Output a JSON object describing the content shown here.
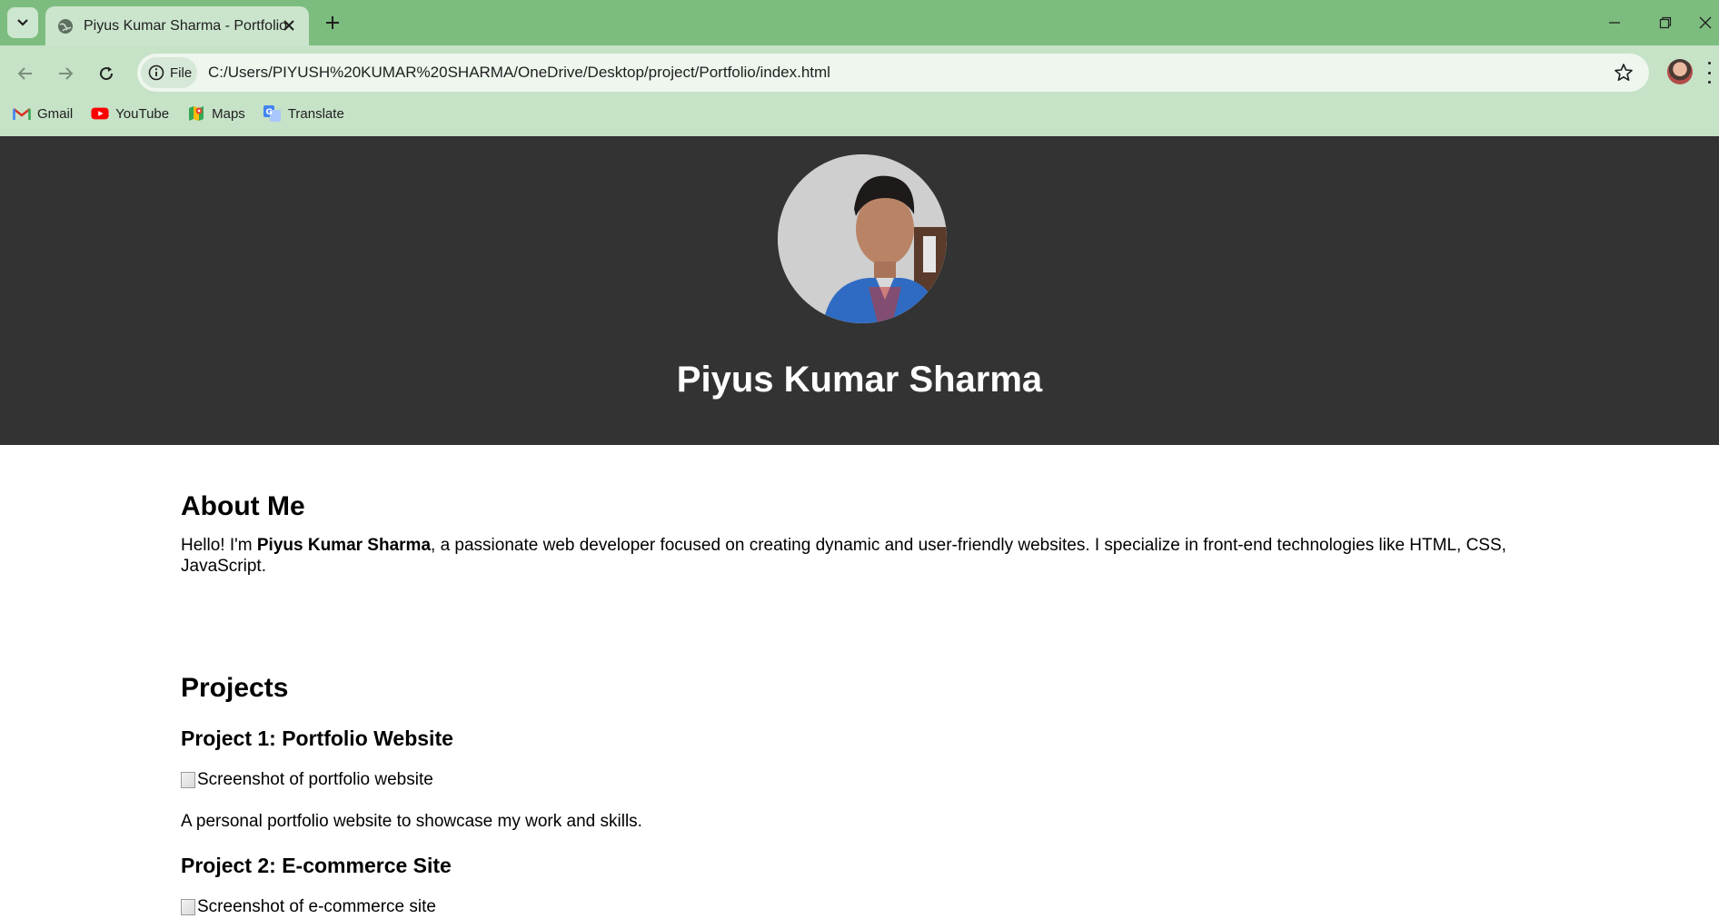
{
  "browser": {
    "tab": {
      "title": "Piyus Kumar Sharma - Portfolio"
    },
    "omnibox": {
      "chip_label": "File",
      "url": "C:/Users/PIYUSH%20KUMAR%20SHARMA/OneDrive/Desktop/project/Portfolio/index.html"
    },
    "bookmarks": [
      {
        "label": "Gmail",
        "icon": "gmail-icon"
      },
      {
        "label": "YouTube",
        "icon": "youtube-icon"
      },
      {
        "label": "Maps",
        "icon": "maps-icon"
      },
      {
        "label": "Translate",
        "icon": "translate-icon"
      }
    ],
    "colors": {
      "tabbar": "#7cbd7f",
      "toolbar": "#c6e2c7",
      "active_tab": "#cbe5cd"
    }
  },
  "page": {
    "header": {
      "name": "Piyus Kumar Sharma",
      "background": "#333333"
    },
    "about": {
      "heading": "About Me",
      "text_before": "Hello! I'm ",
      "text_bold": "Piyus Kumar Sharma",
      "text_after": ", a passionate web developer focused on creating dynamic and user-friendly websites. I specialize in front-end technologies like HTML, CSS, JavaScript."
    },
    "projects": {
      "heading": "Projects",
      "items": [
        {
          "title": "Project 1: Portfolio Website",
          "image_alt": "Screenshot of portfolio website",
          "description": "A personal portfolio website to showcase my work and skills."
        },
        {
          "title": "Project 2: E-commerce Site",
          "image_alt": "Screenshot of e-commerce site"
        }
      ]
    }
  }
}
